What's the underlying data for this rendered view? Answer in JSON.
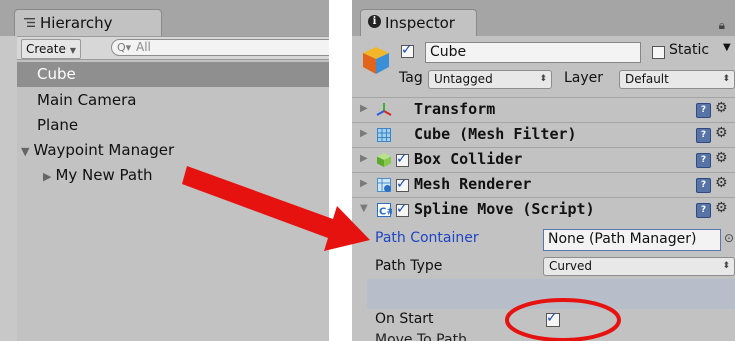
{
  "hierarchy": {
    "tab_title": "Hierarchy",
    "create_label": "Create",
    "search_glyph": "Q▾",
    "search_placeholder": "All",
    "items": [
      {
        "label": "Cube",
        "selected": true
      },
      {
        "label": "Main Camera"
      },
      {
        "label": "Plane"
      },
      {
        "label": "Waypoint Manager",
        "expanded": true
      },
      {
        "label": "My New Path",
        "child": true
      }
    ]
  },
  "inspector": {
    "tab_title": "Inspector",
    "object_name": "Cube",
    "static_label": "Static",
    "tag_label": "Tag",
    "tag_value": "Untagged",
    "layer_label": "Layer",
    "layer_value": "Default",
    "components": [
      {
        "name": "Transform",
        "icon": "transform-icon"
      },
      {
        "name": "Cube (Mesh Filter)",
        "icon": "mesh-filter-icon"
      },
      {
        "name": "Box Collider",
        "icon": "box-collider-icon",
        "enabled": true
      },
      {
        "name": "Mesh Renderer",
        "icon": "mesh-renderer-icon",
        "enabled": true
      },
      {
        "name": "Spline Move (Script)",
        "icon": "script-icon",
        "enabled": true,
        "expanded": true
      }
    ],
    "properties": {
      "path_container_label": "Path Container",
      "path_container_value": "None (Path Manager)",
      "path_type_label": "Path Type",
      "path_type_value": "Curved",
      "on_start_label": "On Start",
      "on_start_checked": true,
      "cut_label": "Move To Path"
    }
  },
  "colors": {
    "accent_red": "#e5120f",
    "selection": "#8f8f8f",
    "link_blue": "#1d45c4"
  }
}
